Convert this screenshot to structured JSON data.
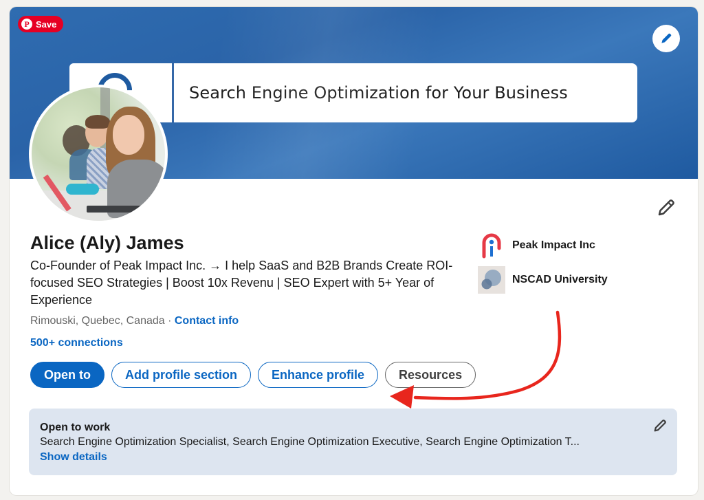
{
  "pinterest": {
    "save_label": "Save",
    "logo_glyph": "P",
    "icon": "pinterest-logo-icon"
  },
  "banner": {
    "title": "Search Engine Optimization for Your Business",
    "edit_icon": "pencil-icon",
    "colors": {
      "background": "#2f6cb0",
      "accent": "#1e5aa0"
    }
  },
  "profile": {
    "name": "Alice (Aly) James",
    "headline": "Co-Founder of Peak Impact Inc. → I help SaaS and B2B Brands Create ROI-focused SEO Strategies | Boost 10x Revenu | SEO Expert with 5+ Year of Experience",
    "location": "Rimouski, Quebec, Canada",
    "separator": " · ",
    "contact_label": "Contact info",
    "connections": "500+ connections",
    "edit_icon": "pencil-icon"
  },
  "organizations": [
    {
      "name": "Peak Impact Inc",
      "logo": "peak-impact-logo",
      "colors": {
        "primary": "#e63946",
        "secondary": "#1d6fd1"
      }
    },
    {
      "name": "NSCAD University",
      "logo": "nscad-logo",
      "colors": {
        "primary": "#8aa2bd",
        "secondary": "#5a7696"
      }
    }
  ],
  "actions": [
    {
      "label": "Open to",
      "style": "primary"
    },
    {
      "label": "Add profile section",
      "style": "outline"
    },
    {
      "label": "Enhance profile",
      "style": "outline"
    },
    {
      "label": "Resources",
      "style": "neutral"
    }
  ],
  "annotation": {
    "type": "curved-arrow",
    "color": "#e8261d",
    "points_to": "Enhance profile"
  },
  "open_to_work": {
    "title": "Open to work",
    "roles": "Search Engine Optimization Specialist, Search Engine Optimization Executive, Search Engine Optimization T...",
    "show_details": "Show details",
    "edit_icon": "pencil-icon",
    "background": "#dde5f0"
  },
  "colors": {
    "brand_blue": "#0a66c2",
    "page_bg": "#f3f2ef",
    "text": "#191919",
    "muted": "#666666"
  }
}
